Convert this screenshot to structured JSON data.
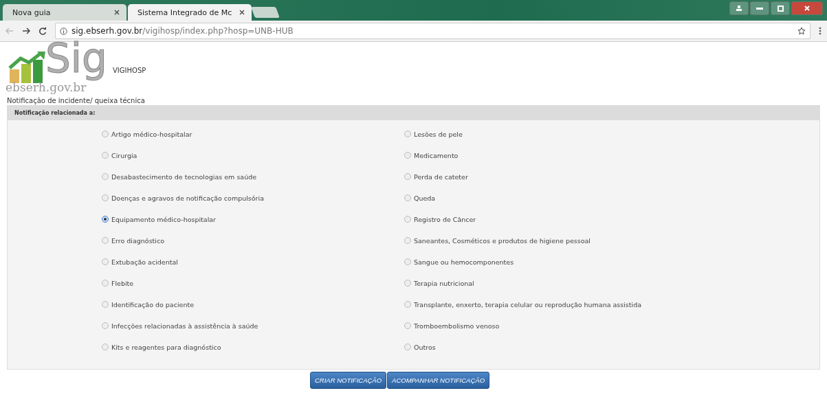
{
  "browser": {
    "tabs": [
      {
        "label": "Nova guia",
        "selected": false
      },
      {
        "label": "Sistema Integrado de Mc",
        "selected": true
      }
    ],
    "address": {
      "host": "sig.ebserh.gov.br",
      "path": "/vigihosp/index.php?hosp=UNB-HUB"
    }
  },
  "logo": {
    "mark": "Sig",
    "domain": "ebserh.gov.br"
  },
  "app_name": "VIGIHOSP",
  "page_title": "Notificação de incidente/ queixa técnica",
  "panel": {
    "header": "Notificação relacionada a:",
    "options": [
      {
        "label": "Artigo médico-hospitalar",
        "selected": false
      },
      {
        "label": "Lesões de pele",
        "selected": false
      },
      {
        "label": "Cirurgia",
        "selected": false
      },
      {
        "label": "Medicamento",
        "selected": false
      },
      {
        "label": "Desabastecimento de tecnologias em saúde",
        "selected": false
      },
      {
        "label": "Perda de cateter",
        "selected": false
      },
      {
        "label": "Doenças e agravos de notificação compulsória",
        "selected": false
      },
      {
        "label": "Queda",
        "selected": false
      },
      {
        "label": "Equipamento médico-hospitalar",
        "selected": true
      },
      {
        "label": "Registro de Câncer",
        "selected": false
      },
      {
        "label": "Erro diagnóstico",
        "selected": false
      },
      {
        "label": "Saneantes, Cosméticos e produtos de higiene pessoal",
        "selected": false
      },
      {
        "label": "Extubação acidental",
        "selected": false
      },
      {
        "label": "Sangue ou hemocomponentes",
        "selected": false
      },
      {
        "label": "Flebite",
        "selected": false
      },
      {
        "label": "Terapia nutricional",
        "selected": false
      },
      {
        "label": "Identificação do paciente",
        "selected": false
      },
      {
        "label": "Transplante, enxerto, terapia celular ou reprodução humana assistida",
        "selected": false
      },
      {
        "label": "Infecções relacionadas à assistência à saúde",
        "selected": false
      },
      {
        "label": "Tromboembolismo venoso",
        "selected": false
      },
      {
        "label": "Kits e reagentes para diagnóstico",
        "selected": false
      },
      {
        "label": "Outros",
        "selected": false
      }
    ]
  },
  "buttons": [
    "CRIAR NOTIFICAÇÃO",
    "ACOMPANHAR NOTIFICAÇÃO"
  ]
}
